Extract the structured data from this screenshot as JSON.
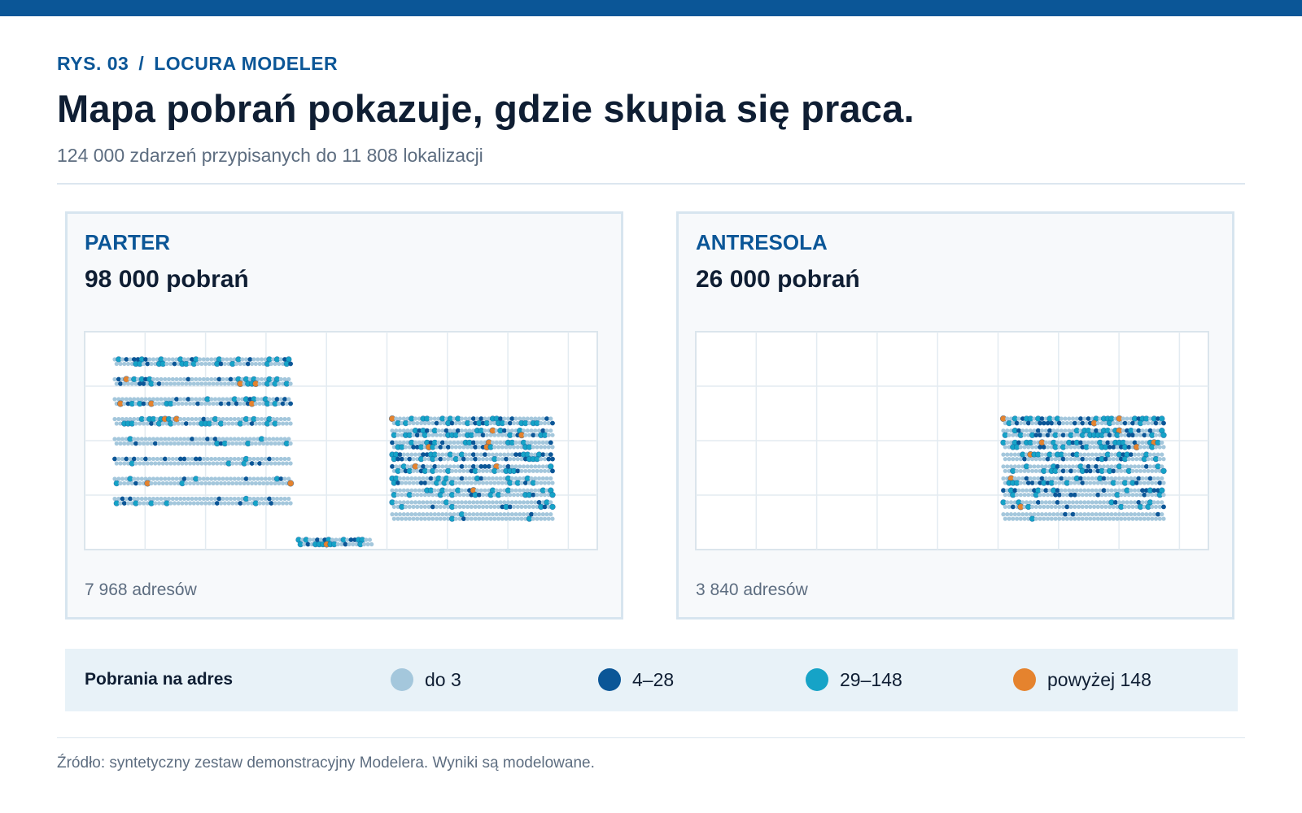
{
  "header": {
    "eyebrow_figure": "RYS. 03",
    "eyebrow_separator": "/",
    "eyebrow_product": "LOCURA MODELER",
    "title": "Mapa pobrań pokazuje, gdzie skupia się praca.",
    "subtitle": "124 000 zdarzeń przypisanych do 11 808 lokalizacji"
  },
  "panels": [
    {
      "title": "PARTER",
      "value": "98 000 pobrań",
      "footer": "7 968 adresów"
    },
    {
      "title": "ANTRESOLA",
      "value": "26 000 pobrań",
      "footer": "3 840 adresów"
    }
  ],
  "legend": {
    "title": "Pobrania na adres",
    "items": [
      {
        "label": "do 3",
        "color": "#a4c7dc"
      },
      {
        "label": "4–28",
        "color": "#0b5697"
      },
      {
        "label": "29–148",
        "color": "#16a3c7"
      },
      {
        "label": "powyżej 148",
        "color": "#e5832e"
      }
    ]
  },
  "footer": {
    "source": "Źródło: syntetyczny zestaw demonstracyjny Modelera. Wyniki są modelowane."
  },
  "chart_data": {
    "type": "scatter",
    "encoding": "pick locations on floor map, colored by picks per address bin",
    "bins": [
      "do 3",
      "4–28",
      "29–148",
      "powyżej 148"
    ],
    "bin_colors": [
      "#a4c7dc",
      "#0b5697",
      "#16a3c7",
      "#e5832e"
    ],
    "maps": [
      {
        "panel": "PARTER",
        "total_picks": 98000,
        "addresses": 7968,
        "zones": [
          {
            "rows": 8,
            "cols": 46,
            "heat": [
              0.55,
              0.5,
              0.45,
              0.35,
              0.28,
              0.22,
              0.18,
              0.14
            ]
          },
          {
            "rows": 9,
            "cols": 42,
            "heat": [
              0.6,
              0.58,
              0.55,
              0.5,
              0.45,
              0.4,
              0.35,
              0.3,
              0.1
            ]
          },
          {
            "rows": 1,
            "cols": 20,
            "heat": [
              0.75
            ]
          }
        ]
      },
      {
        "panel": "ANTRESOLA",
        "total_picks": 26000,
        "addresses": 3840,
        "zones": [
          {
            "rows": 9,
            "cols": 42,
            "heat": [
              0.6,
              0.58,
              0.55,
              0.52,
              0.48,
              0.44,
              0.4,
              0.35,
              0.1
            ]
          }
        ]
      }
    ]
  }
}
